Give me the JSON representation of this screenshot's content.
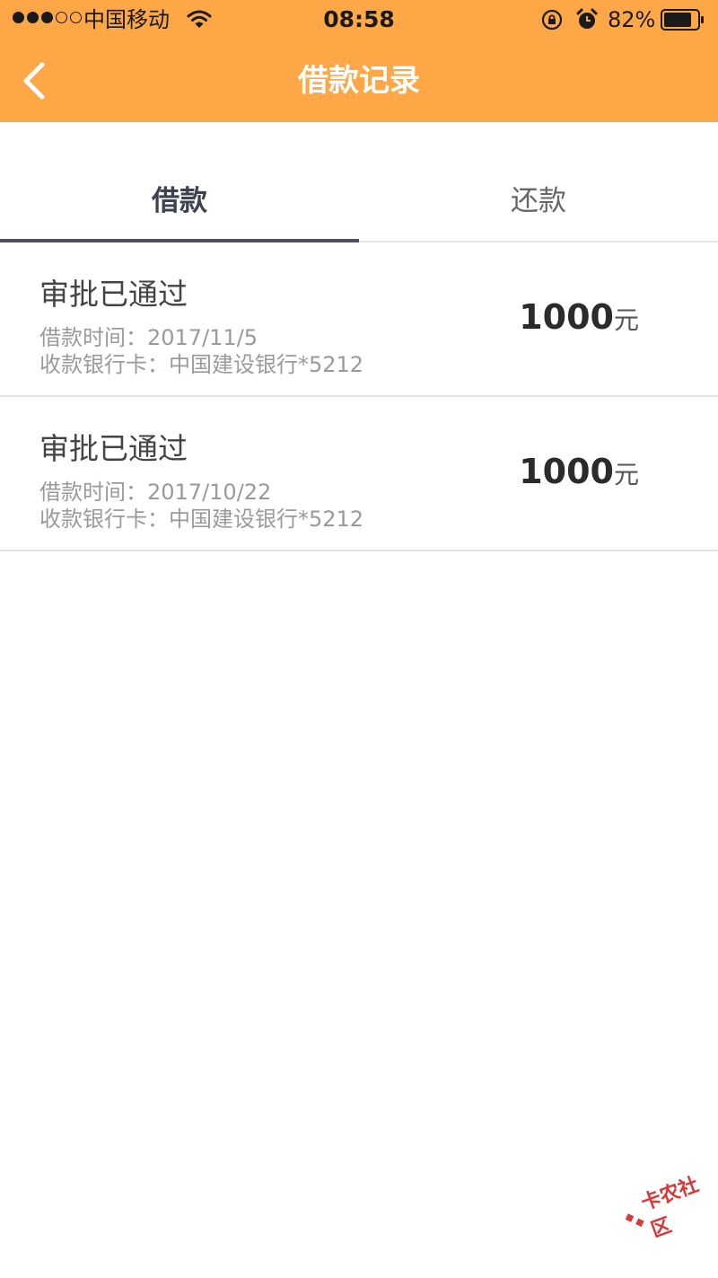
{
  "status_bar": {
    "carrier": "中国移动",
    "time": "08:58",
    "battery_percent": "82%"
  },
  "nav": {
    "title": "借款记录"
  },
  "tabs": [
    {
      "label": "借款",
      "active": true
    },
    {
      "label": "还款",
      "active": false
    }
  ],
  "records": [
    {
      "status": "审批已通过",
      "date": "借款时间：2017/11/5",
      "bank": "收款银行卡：中国建设银行*5212",
      "amount": "1000",
      "unit": "元"
    },
    {
      "status": "审批已通过",
      "date": "借款时间：2017/10/22",
      "bank": "收款银行卡：中国建设银行*5212",
      "amount": "1000",
      "unit": "元"
    }
  ],
  "watermark": "卡农社区",
  "colors": {
    "header_bg": "#fda746",
    "tab_indicator": "#4e5060"
  },
  "icons": {
    "back": "chevron-left-icon",
    "wifi": "wifi-icon",
    "lock": "orientation-lock-icon",
    "alarm": "alarm-icon",
    "battery": "battery-icon"
  }
}
